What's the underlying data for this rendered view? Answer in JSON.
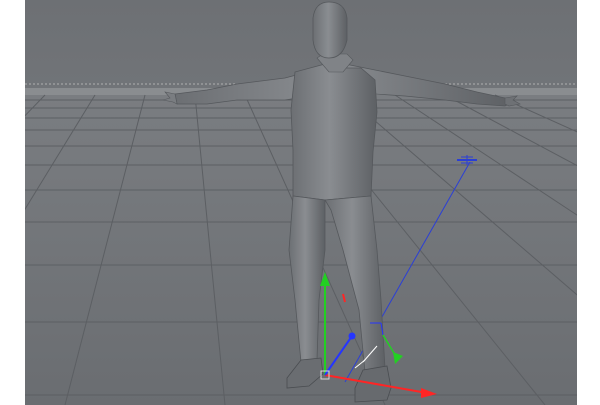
{
  "viewport": {
    "background_color": "#6f7276",
    "horizon_color": "#8a8d90",
    "grid_color": "#5a5d61",
    "frame_color": "#b8b8b8",
    "model_color": "#7c7f83",
    "axis_x_color": "#ff2020",
    "axis_y_color": "#20d020",
    "axis_z_color": "#2040ff"
  },
  "model": {
    "name": ""
  },
  "icons": {
    "move_gizmo": "move-gizmo-icon",
    "world_axis": "world-axis-icon",
    "light": "light-icon"
  }
}
